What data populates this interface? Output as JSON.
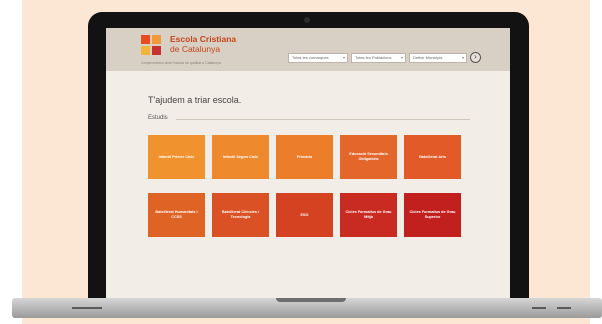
{
  "site": {
    "brand_line1": "Escola Cristiana",
    "brand_line2": "de Catalunya",
    "tagline": "Compromesos amb l'escola de qualitat a Catalunya",
    "logo_colors": [
      "#e94b1f",
      "#f29a3a",
      "#f2b53b",
      "#c8322e"
    ]
  },
  "filters": [
    {
      "label": "Totes les comarques"
    },
    {
      "label": "Totes les Poblacions"
    },
    {
      "label": "Definir Municipis"
    }
  ],
  "page": {
    "title": "T'ajudem a triar escola.",
    "section_label": "Estudis"
  },
  "tiles": [
    {
      "label": "Infantil Primer Cicle",
      "color": "#f0922e"
    },
    {
      "label": "Infantil Segon Cicle",
      "color": "#ee8a2d"
    },
    {
      "label": "Primària",
      "color": "#eb7d2b"
    },
    {
      "label": "Educació Secundària Obligatòria",
      "color": "#e5662a"
    },
    {
      "label": "Batxillerat Arts",
      "color": "#e15a27"
    },
    {
      "label": "Batxillerat Humanitats i CCSS",
      "color": "#e06326"
    },
    {
      "label": "Batxillerat Ciències i Tecnologia",
      "color": "#d95124"
    },
    {
      "label": "ESO",
      "color": "#d44222"
    },
    {
      "label": "Cicles Formatius de Grau Mitjà",
      "color": "#c92a21"
    },
    {
      "label": "Cicles Formatius de Grau Superior",
      "color": "#c2201f"
    }
  ]
}
